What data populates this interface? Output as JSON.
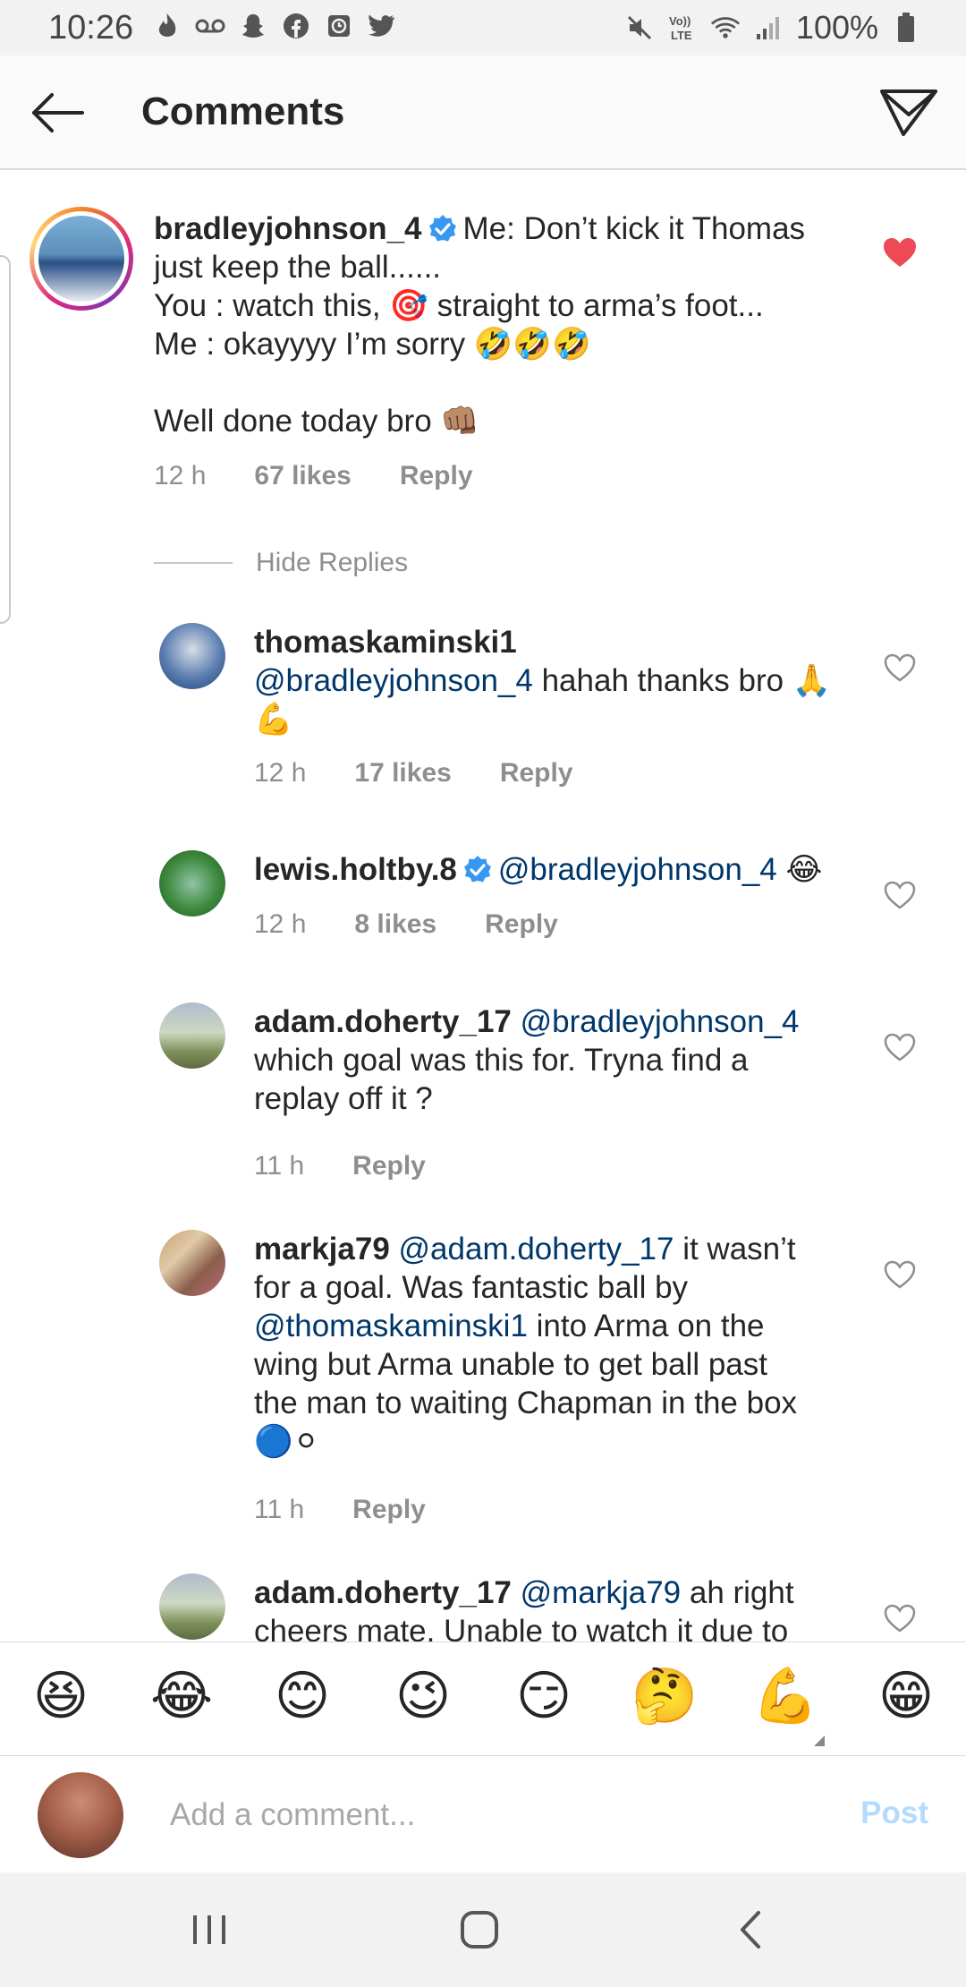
{
  "status_bar": {
    "time": "10:26",
    "battery": "100%",
    "icons_left": [
      "tinder-icon",
      "voicemail-icon",
      "snapchat-icon",
      "facebook-icon",
      "clock-icon",
      "twitter-icon"
    ],
    "icons_right": [
      "mute-icon",
      "volte-icon",
      "wifi-icon",
      "signal-icon",
      "battery-icon"
    ]
  },
  "header": {
    "title": "Comments"
  },
  "colors": {
    "link": "#00376b",
    "liked_heart": "#ed4956",
    "meta": "#8e8e8e",
    "post_disabled": "#b3dbff"
  },
  "main_comment": {
    "username": "bradleyjohnson_4",
    "verified": true,
    "lines": [
      "Me: Don’t kick it Thomas",
      "just keep the ball......",
      "You : watch this, 🎯 straight to arma’s foot...",
      "Me : okayyyy I’m sorry 🤣🤣🤣",
      "",
      "Well done today bro 👊🏽"
    ],
    "time": "12 h",
    "likes": "67 likes",
    "reply": "Reply",
    "liked": true
  },
  "hide_replies": "Hide Replies",
  "replies": [
    {
      "username": "thomaskaminski1",
      "mention": "@bradleyjohnson_4",
      "text": " hahah thanks bro 🙏",
      "text2": "💪",
      "time": "12 h",
      "likes": "17 likes",
      "reply": "Reply"
    },
    {
      "username": "lewis.holtby.8",
      "verified": true,
      "mention": "@bradleyjohnson_4",
      "text": " 😂",
      "time": "12 h",
      "likes": "8 likes",
      "reply": "Reply"
    },
    {
      "username": "adam.doherty_17",
      "mention": "@bradleyjohnson_4",
      "line2": "which goal was this for. Tryna find a",
      "line3": "replay off it ?",
      "time": "11 h",
      "reply": "Reply"
    },
    {
      "username": "markja79",
      "mention": "@adam.doherty_17",
      "text": " it wasn’t",
      "line2": "for a goal. Was fantastic ball by",
      "mention2": "@thomaskaminski1",
      "line3": " into Arma on the",
      "line4": "wing but Arma unable to get ball past",
      "line5": "the man to waiting Chapman in the box",
      "line6": "🔵⚪",
      "time": "11 h",
      "reply": "Reply"
    },
    {
      "username": "adam.doherty_17",
      "mention": "@markja79",
      "text": " ah right",
      "line2": "cheers mate. Unable to watch it due to"
    }
  ],
  "emoji_bar": [
    "😆",
    "😂",
    "😊",
    "😉",
    "😏",
    "🤔",
    "💪",
    "😁"
  ],
  "input": {
    "placeholder": "Add a comment...",
    "post": "Post"
  }
}
